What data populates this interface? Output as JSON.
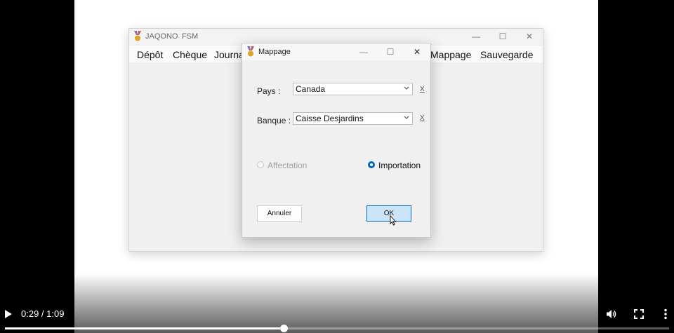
{
  "player": {
    "time": "0:29 / 1:09",
    "progress_fraction": 0.42,
    "play_icon": "play-icon",
    "volume_icon": "volume-icon",
    "fullscreen_icon": "fullscreen-icon",
    "menu_icon": "more-vert-icon"
  },
  "main_window": {
    "title": "JAQONO",
    "subtitle": "FSM",
    "controls": {
      "minimize": "—",
      "maximize": "☐",
      "close": "✕"
    },
    "menu": [
      "Dépôt",
      "Chèque",
      "Journa",
      "Mappage",
      "Sauvegarde"
    ]
  },
  "dialog": {
    "title": "Mappage",
    "controls": {
      "minimize": "—",
      "maximize": "☐",
      "close": "✕"
    },
    "pays_label": "Pays :",
    "pays_value": "Canada",
    "banque_label": "Banque :",
    "banque_value": "Caisse Desjardins",
    "clear_label": "X",
    "radio_affectation": "Affectation",
    "radio_importation": "Importation",
    "cancel_label": "Annuler",
    "ok_label": "OK"
  },
  "colors": {
    "accent": "#0067c0",
    "ok_bg": "#cce4f7",
    "disabled_text": "#a0a0a0"
  }
}
